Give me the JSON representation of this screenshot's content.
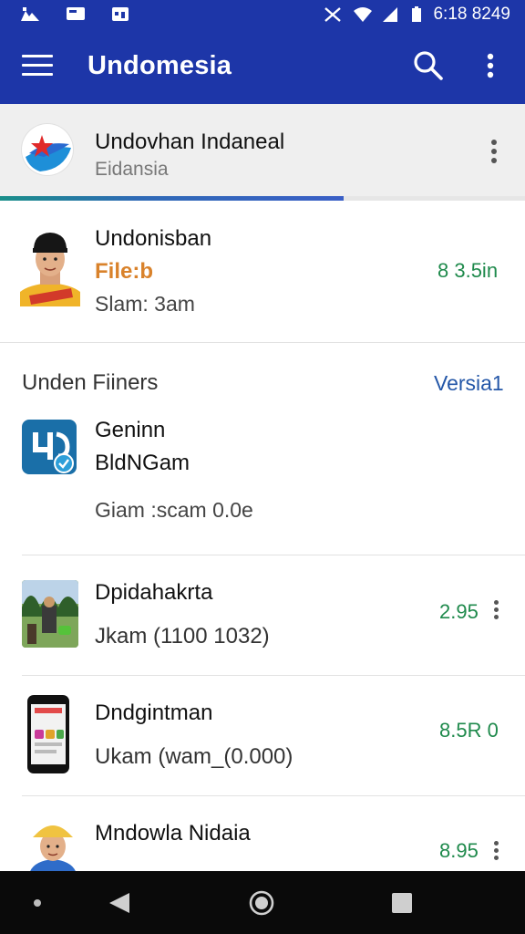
{
  "status_bar": {
    "time": "6:18 8249",
    "icons": [
      "notification-icon",
      "mail-icon",
      "calendar-icon",
      "mute-icon",
      "wifi-icon",
      "signal-icon",
      "battery-icon"
    ]
  },
  "app_bar": {
    "title": "Undomesia",
    "icons": [
      "menu-icon",
      "search-icon",
      "more-vert-icon"
    ]
  },
  "account": {
    "name": "Undovhan Indaneal",
    "subtitle": "Eidansia",
    "progress": 0.655
  },
  "featured": {
    "title": "Undonisban",
    "subtitle": "File:b",
    "meta": "Slam: 3am",
    "price": "8 3.5in"
  },
  "section": {
    "header": "Unden Fiiners",
    "link": "Versia1"
  },
  "items": [
    {
      "title": "Geninn",
      "line2": "BldNGam",
      "line3": "Giam :scam 0.0e",
      "price": ""
    },
    {
      "title": "Dpidahakrta",
      "line2": "Jkam (1100 1032)",
      "price": "2.95"
    },
    {
      "title": "Dndgintman",
      "line2": "Ukam (wam_(0.000)",
      "price": "8.5R 0"
    },
    {
      "title": "Mndowla Nidaia",
      "line2": "",
      "price": "8.95"
    }
  ],
  "colors": {
    "primary": "#1d36a8",
    "price_green": "#1f8a4c",
    "accent_orange": "#d9822b",
    "link_blue": "#2457a8"
  }
}
